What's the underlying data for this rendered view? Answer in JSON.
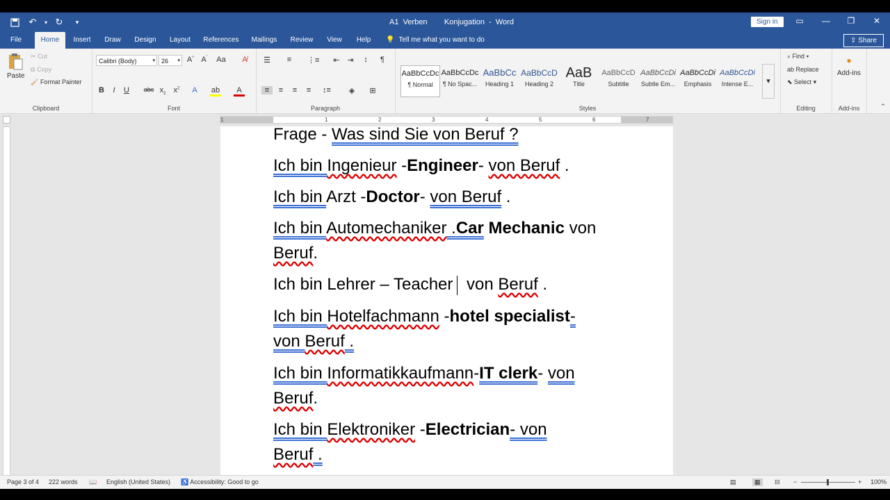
{
  "window": {
    "doc_title": "A1  Verben        Konjugation  -  Word",
    "sign_in": "Sign in",
    "share": "Share"
  },
  "tabs": [
    "File",
    "Home",
    "Insert",
    "Draw",
    "Design",
    "Layout",
    "References",
    "Mailings",
    "Review",
    "View",
    "Help"
  ],
  "tell_me": "Tell me what you want to do",
  "ribbon": {
    "clipboard": {
      "paste": "Paste",
      "cut": "Cut",
      "copy": "Copy",
      "format_painter": "Format Painter",
      "label": "Clipboard"
    },
    "font": {
      "name": "Calibri (Body)",
      "size": "26",
      "label": "Font"
    },
    "paragraph": {
      "label": "Paragraph"
    },
    "styles": {
      "label": "Styles",
      "items": [
        {
          "preview": "AaBbCcDc",
          "name": "¶ Normal"
        },
        {
          "preview": "AaBbCcDc",
          "name": "¶ No Spac..."
        },
        {
          "preview": "AaBbCc",
          "name": "Heading 1"
        },
        {
          "preview": "AaBbCcD",
          "name": "Heading 2"
        },
        {
          "preview": "AaB",
          "name": "Title"
        },
        {
          "preview": "AaBbCcD",
          "name": "Subtitle"
        },
        {
          "preview": "AaBbCcDi",
          "name": "Subtle Em..."
        },
        {
          "preview": "AaBbCcDi",
          "name": "Emphasis"
        },
        {
          "preview": "AaBbCcDi",
          "name": "Intense E..."
        }
      ]
    },
    "editing": {
      "find": "Find",
      "replace": "Replace",
      "select": "Select",
      "label": "Editing"
    },
    "addins": {
      "button": "Add-ins",
      "label": "Add-ins"
    }
  },
  "ruler_numbers": [
    "1",
    "1",
    "2",
    "3",
    "4",
    "5",
    "6",
    "7"
  ],
  "document": {
    "line1_a": "Frage - ",
    "line1_b": "Was  sind  Sie  von  Beruf  ?",
    "line2_a": "Ich  bin  ",
    "line2_b": "Ingenieur",
    "line2_c": " -",
    "line2_d": "Engineer",
    "line2_e": "- ",
    "line2_f": "von  Beruf",
    "line2_g": " .",
    "line3_a": "Ich  bin  ",
    "line3_b": "Arzt -",
    "line3_c": "Doctor",
    "line3_d": "- ",
    "line3_e": "von  Beruf",
    "line3_f": " .",
    "line4_a": "Ich  bin  ",
    "line4_b": "Automechaniker",
    "line4_c": " .",
    "line4_d": "Car",
    "line4_e": " Mechanic",
    "line4_f": " von",
    "line5_a": "Beruf",
    "line5_b": ".",
    "line6_a": "Ich  bin   Lehrer – Teacher",
    "line6_b": " von   ",
    "line6_c": "Beruf",
    "line6_d": " .",
    "line7_a": "Ich  bin   ",
    "line7_b": "Hotelfachmann",
    "line7_c": " -",
    "line7_d": "hotel specialist",
    "line7_e": "- ",
    "line8_a": "von  ",
    "line8_b": "Beruf",
    "line8_c": " .",
    "line9_a": "Ich  bin  ",
    "line9_b": "Informatikkaufmann",
    "line9_c": "-",
    "line9_d": "IT  clerk",
    "line9_e": "-   ",
    "line9_f": "von ",
    "line10_a": "Beruf",
    "line10_b": ".",
    "line11_a": "Ich  bin  ",
    "line11_b": "Elektroniker",
    "line11_c": " -",
    "line11_d": "Electrician",
    "line11_e": "-  von",
    "line12_a": "Beruf",
    "line12_b": " ."
  },
  "status": {
    "page": "Page 3 of 4",
    "words": "222 words",
    "language": "English (United States)",
    "accessibility": "Accessibility: Good to go",
    "zoom": "100%"
  },
  "colors": {
    "word_blue": "#2b579a",
    "ribbon_bg": "#f3f3f3",
    "spell_red": "#d00",
    "grammar_blue": "#3b6fd4"
  }
}
